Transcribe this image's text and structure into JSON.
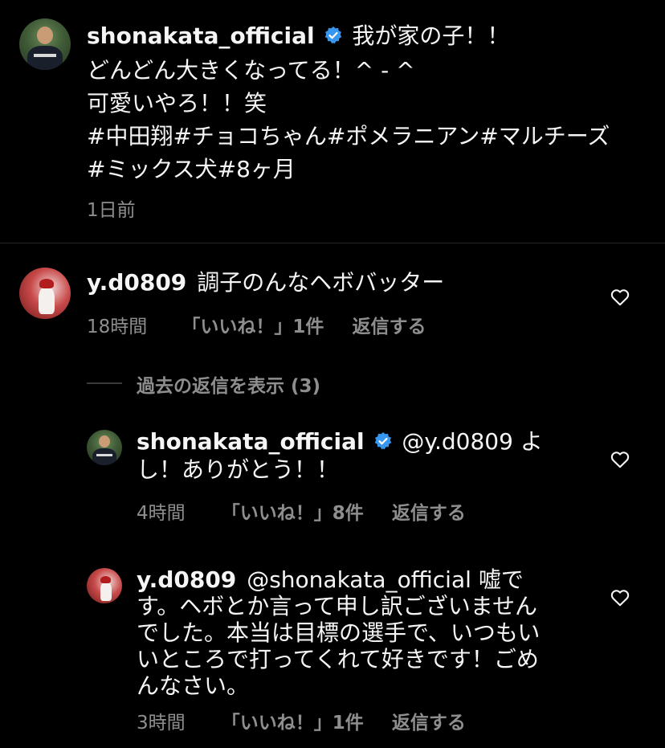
{
  "post": {
    "username": "shonakata_official",
    "caption_lines": [
      "我が家の子！！",
      "どんどん大きくなってる！^ - ^",
      "可愛いやろ！！笑",
      "#中田翔#チョコちゃん#ポメラニアン#マルチーズ",
      "#ミックス犬#8ヶ月"
    ],
    "time": "1日前"
  },
  "comment": {
    "username": "y.d0809",
    "text": "調子のんなヘボバッター",
    "time": "18時間",
    "likes": "「いいね！」1件",
    "reply": "返信する"
  },
  "view_replies": "過去の返信を表示 (3)",
  "replies": [
    {
      "username": "shonakata_official",
      "mention": "@y.d0809",
      "text_lines": [
        "よ",
        "し！ありがとう！！"
      ],
      "time": "4時間",
      "likes": "「いいね！」8件",
      "reply": "返信する"
    },
    {
      "username": "y.d0809",
      "mention": "@shonakata_official",
      "text_lines": [
        "嘘で",
        "す。ヘボとか言って申し訳ございません",
        "でした。本当は目標の選手で、いつもい",
        "いところで打ってくれて好きです！ごめ",
        "んなさい。"
      ],
      "time": "3時間",
      "likes": "「いいね！」1件",
      "reply": "返信する"
    }
  ],
  "colors": {
    "background": "#000000",
    "text": "#f5f5f5",
    "meta": "#8e8e8e",
    "verified": "#3797f0",
    "divider": "#262626"
  },
  "icons": {
    "verified": "verified-badge-icon",
    "like": "heart-outline-icon"
  }
}
